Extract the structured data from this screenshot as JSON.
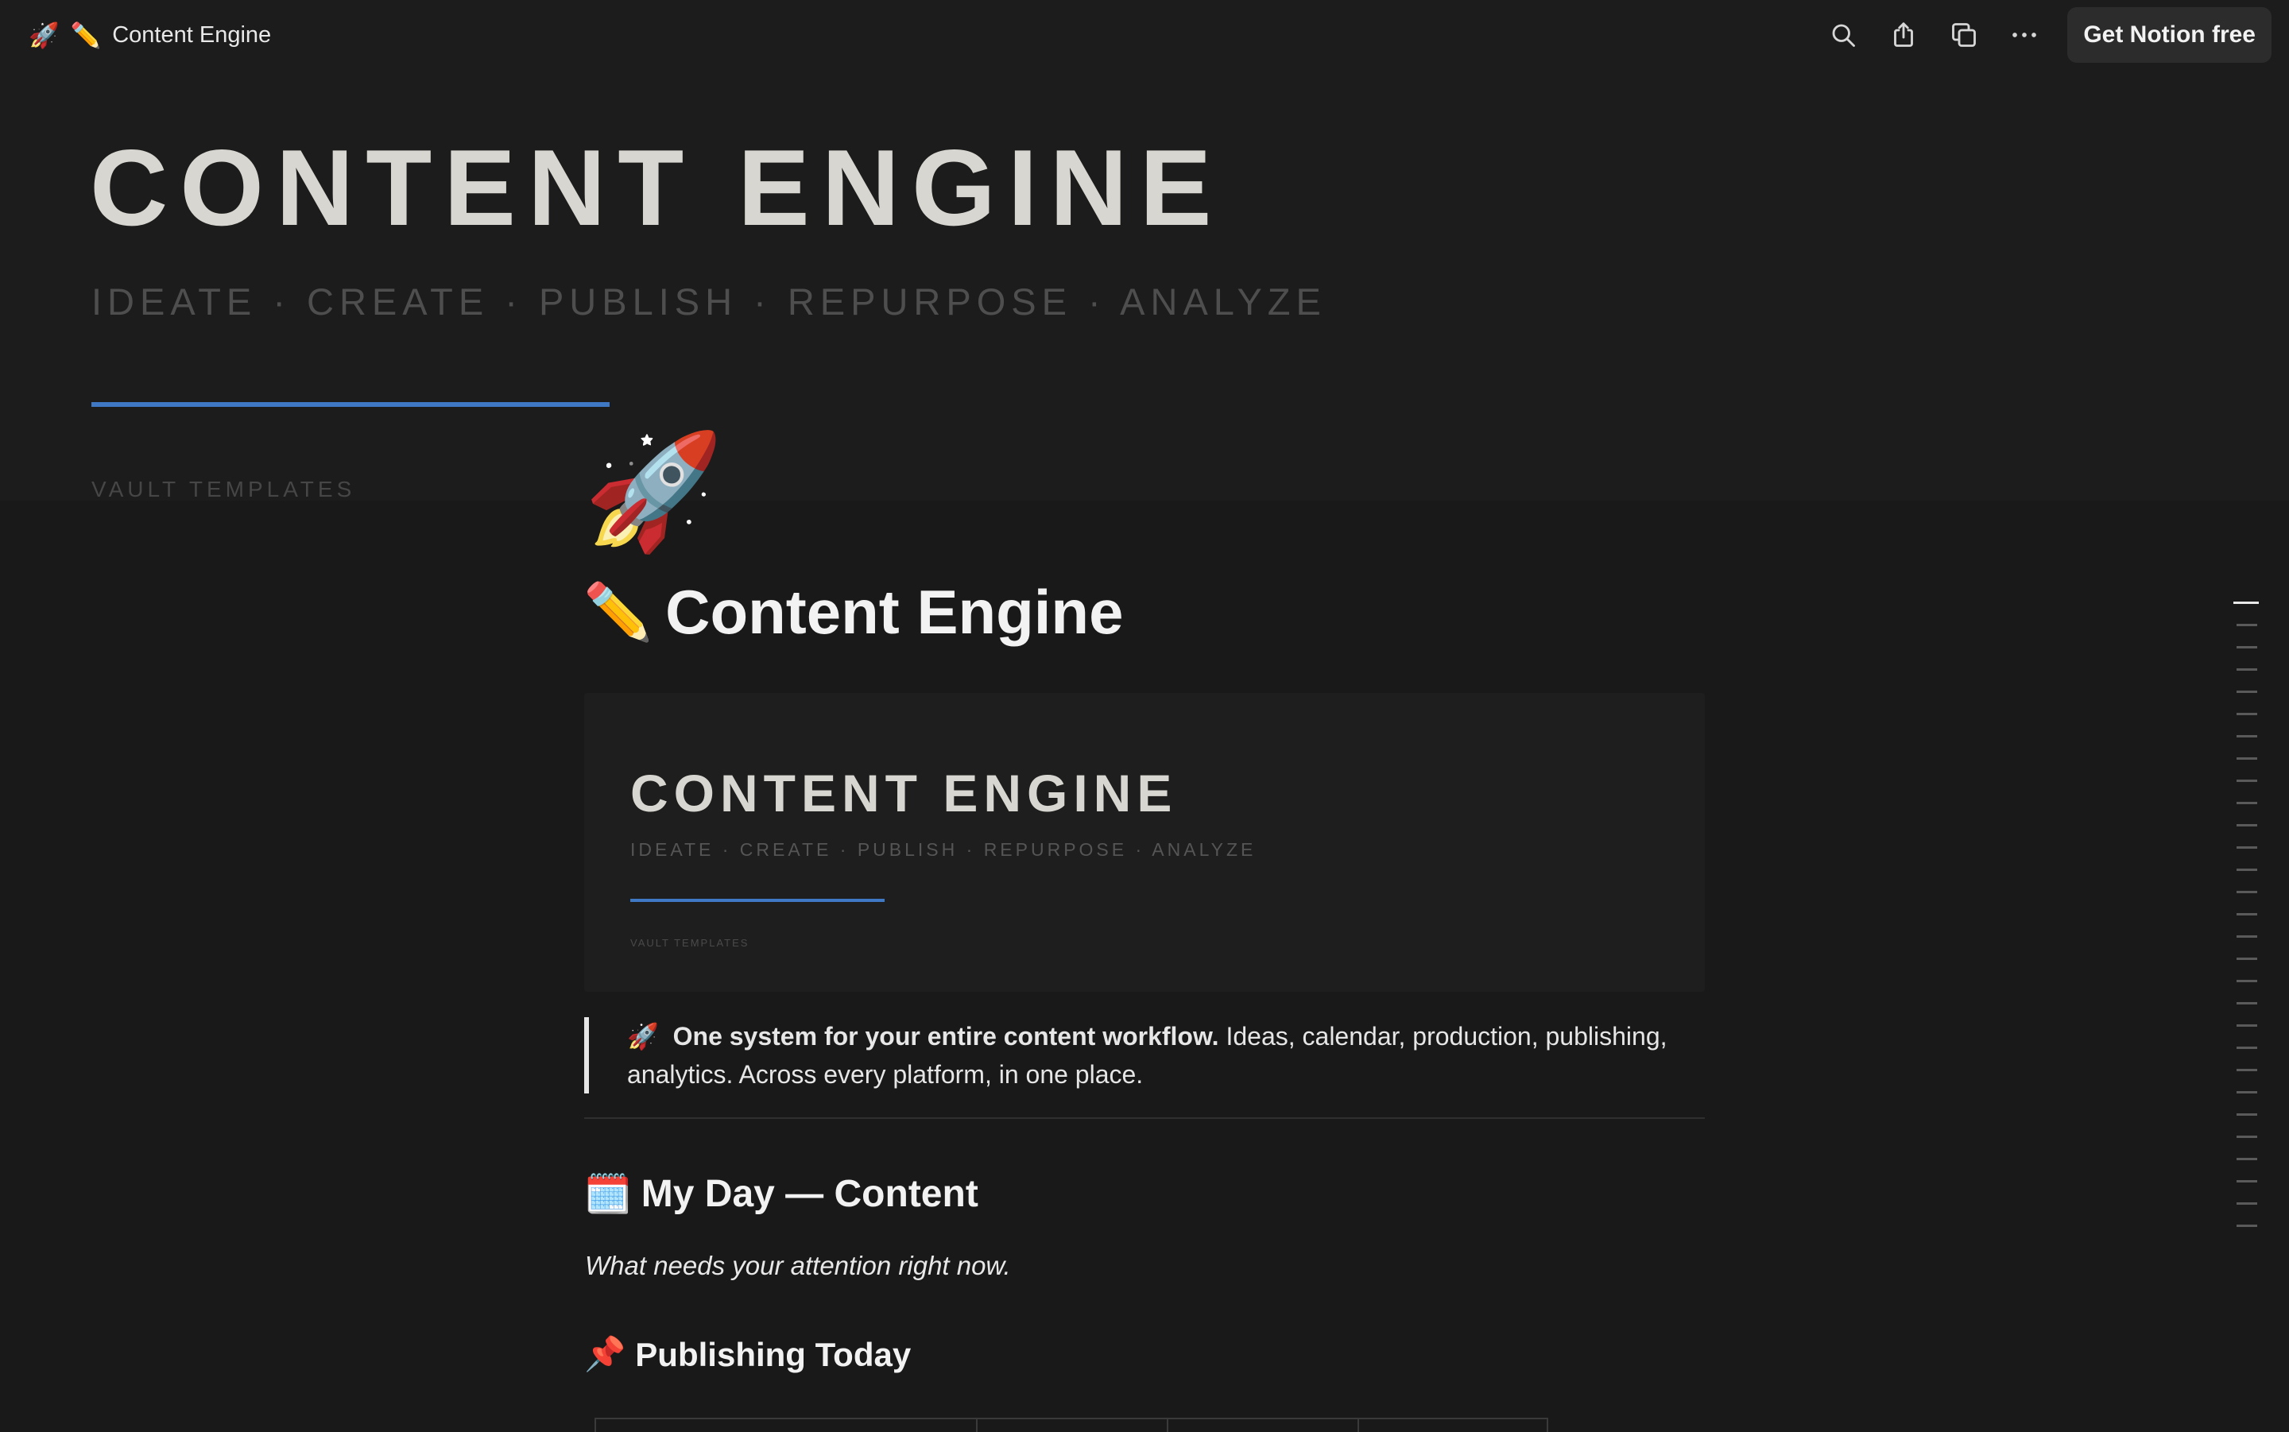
{
  "topbar": {
    "icons": [
      "rocket-emoji",
      "pencil-emoji"
    ],
    "rocket": "🚀",
    "pencil": "✏️",
    "title": "Content Engine",
    "actions": [
      "search-icon",
      "share-icon",
      "duplicate-icon",
      "more-icon"
    ],
    "cta_label": "Get Notion free"
  },
  "cover": {
    "title": "CONTENT ENGINE",
    "subtitle": "IDEATE · CREATE · PUBLISH · REPURPOSE · ANALYZE",
    "vault": "VAULT TEMPLATES",
    "accent_color": "#3f78c4"
  },
  "page": {
    "icon": "🚀",
    "title_emoji": "✏️",
    "title": "Content Engine"
  },
  "embed": {
    "title": "CONTENT ENGINE",
    "subtitle": "IDEATE · CREATE · PUBLISH · REPURPOSE · ANALYZE",
    "vault": "VAULT TEMPLATES"
  },
  "callout": {
    "emoji": "🚀",
    "bold": "One system for your entire content workflow.",
    "text": " Ideas, calendar, production, publishing, analytics. Across every platform, in one place."
  },
  "my_day": {
    "emoji": "🗓️",
    "heading": "My Day — Content",
    "note": "What needs your attention right now."
  },
  "publishing_today": {
    "emoji": "📌",
    "heading": "Publishing Today"
  },
  "outline": {
    "entries": 29,
    "active_index": 0
  }
}
